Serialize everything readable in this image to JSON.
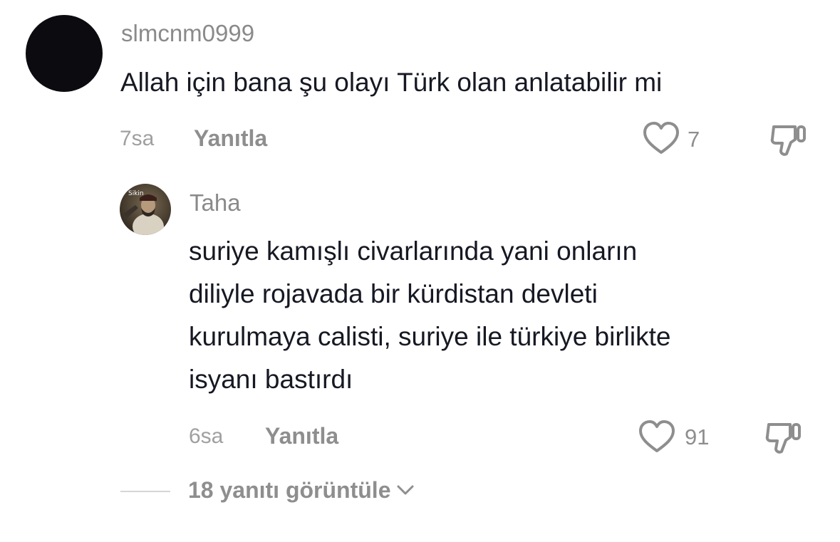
{
  "comment": {
    "username": "slmcnm0999",
    "text": "Allah için bana şu olayı Türk olan anlatabilir mi",
    "time": "7sa",
    "reply_label": "Yanıtla",
    "like_count": "7",
    "avatar_color": "#0b0b10"
  },
  "reply": {
    "username": "Taha",
    "avatar_label": "Sikin",
    "lines": [
      "suriye kamışlı civarlarında yani onların",
      "diliyle rojavada bir kürdistan devleti",
      "kurulmaya calisti, suriye ile türkiye birlikte",
      "isyanı bastırdı"
    ],
    "time": "6sa",
    "reply_label": "Yanıtla",
    "like_count": "91"
  },
  "view_replies": {
    "label": "18 yanıtı görüntüle"
  },
  "icons": {
    "like": "heart-outline-icon",
    "dislike": "thumbs-down-icon",
    "expand": "chevron-down-icon"
  },
  "colors": {
    "primary_text": "#161823",
    "secondary_text": "#8e8e8e",
    "icon_stroke": "#8e8e8e"
  }
}
